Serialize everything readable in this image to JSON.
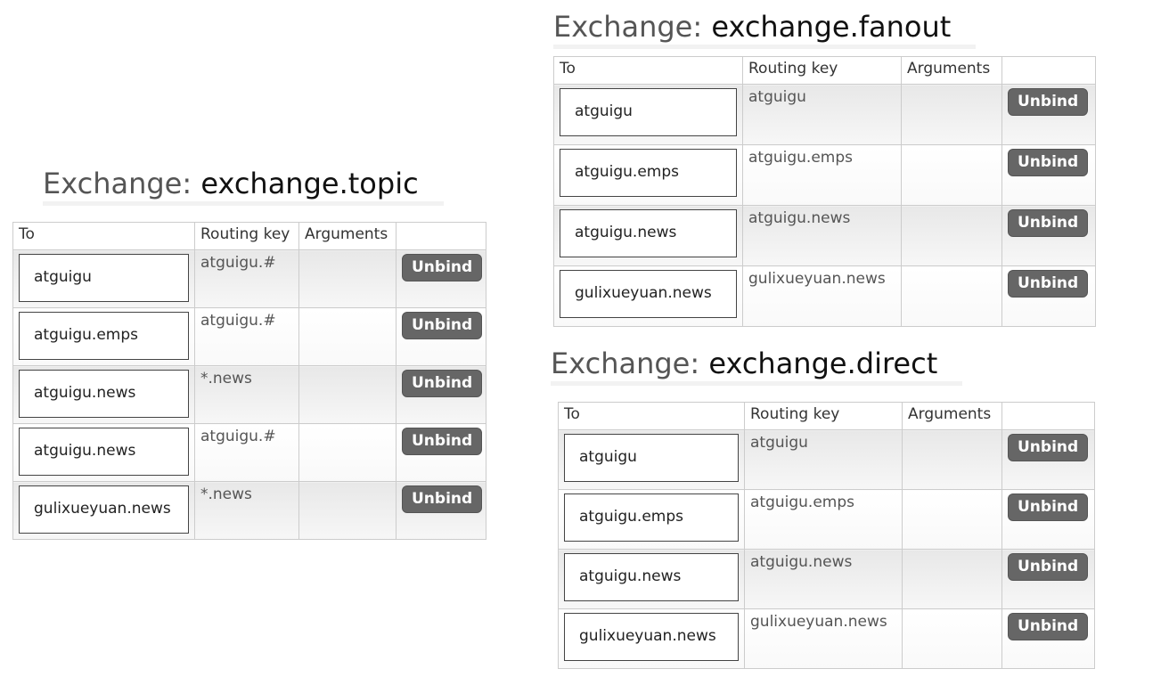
{
  "panels": [
    {
      "label": "Exchange:",
      "name": "exchange.topic",
      "columns": [
        "To",
        "Routing key",
        "Arguments",
        ""
      ],
      "action_label": "Unbind",
      "rows": [
        {
          "to": "atguigu",
          "routing_key": "atguigu.#",
          "arguments": ""
        },
        {
          "to": "atguigu.emps",
          "routing_key": "atguigu.#",
          "arguments": ""
        },
        {
          "to": "atguigu.news",
          "routing_key": "*.news",
          "arguments": ""
        },
        {
          "to": "atguigu.news",
          "routing_key": "atguigu.#",
          "arguments": ""
        },
        {
          "to": "gulixueyuan.news",
          "routing_key": "*.news",
          "arguments": ""
        }
      ]
    },
    {
      "label": "Exchange:",
      "name": "exchange.fanout",
      "columns": [
        "To",
        "Routing key",
        "Arguments",
        ""
      ],
      "action_label": "Unbind",
      "rows": [
        {
          "to": "atguigu",
          "routing_key": "atguigu",
          "arguments": ""
        },
        {
          "to": "atguigu.emps",
          "routing_key": "atguigu.emps",
          "arguments": ""
        },
        {
          "to": "atguigu.news",
          "routing_key": "atguigu.news",
          "arguments": ""
        },
        {
          "to": "gulixueyuan.news",
          "routing_key": "gulixueyuan.news",
          "arguments": ""
        }
      ]
    },
    {
      "label": "Exchange:",
      "name": "exchange.direct",
      "columns": [
        "To",
        "Routing key",
        "Arguments",
        ""
      ],
      "action_label": "Unbind",
      "rows": [
        {
          "to": "atguigu",
          "routing_key": "atguigu",
          "arguments": ""
        },
        {
          "to": "atguigu.emps",
          "routing_key": "atguigu.emps",
          "arguments": ""
        },
        {
          "to": "atguigu.news",
          "routing_key": "atguigu.news",
          "arguments": ""
        },
        {
          "to": "gulixueyuan.news",
          "routing_key": "gulixueyuan.news",
          "arguments": ""
        }
      ]
    }
  ]
}
